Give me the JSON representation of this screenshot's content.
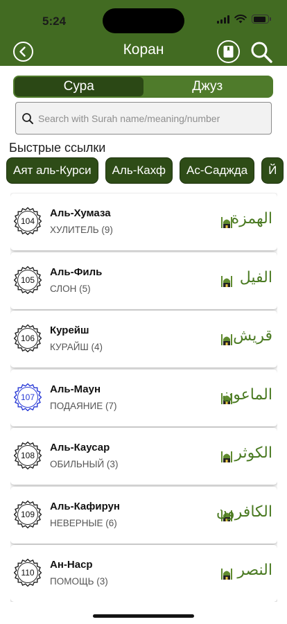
{
  "status": {
    "time": "5:24",
    "battery_level": 0.85
  },
  "nav": {
    "title": "Коран"
  },
  "tabs": [
    {
      "label": "Сура",
      "active": true
    },
    {
      "label": "Джуз",
      "active": false
    }
  ],
  "search": {
    "placeholder": "Search with Surah name/meaning/number",
    "value": ""
  },
  "quick_links": {
    "title": "Быстрые ссылки",
    "items": [
      "Аят аль-Курси",
      "Аль-Кахф",
      "Ас-Саджда",
      "Й"
    ]
  },
  "surahs": [
    {
      "number": "104",
      "name": "Аль-Хумаза",
      "meaning": "ХУЛИТЕЛЬ (9)",
      "arabic": "الهمزة",
      "active": false
    },
    {
      "number": "105",
      "name": "Аль-Филь",
      "meaning": "СЛОН (5)",
      "arabic": "الفيل",
      "active": false
    },
    {
      "number": "106",
      "name": "Курейш",
      "meaning": "КУРАЙШ (4)",
      "arabic": "قريش",
      "active": false
    },
    {
      "number": "107",
      "name": "Аль-Маун",
      "meaning": "ПОДАЯНИЕ (7)",
      "arabic": "الماعون",
      "active": true
    },
    {
      "number": "108",
      "name": "Аль-Каусар",
      "meaning": "ОБИЛЬНЫЙ (3)",
      "arabic": "الكوثر",
      "active": false
    },
    {
      "number": "109",
      "name": "Аль-Кафирун",
      "meaning": "НЕВЕРНЫЕ (6)",
      "arabic": "الكافرون",
      "active": false
    },
    {
      "number": "110",
      "name": "Ан-Наср",
      "meaning": "ПОМОЩЬ (3)",
      "arabic": "النصر",
      "active": false
    }
  ],
  "colors": {
    "header_green": "#426b22",
    "chip_green": "#2e4c17",
    "active_badge": "#2a3bd6"
  }
}
